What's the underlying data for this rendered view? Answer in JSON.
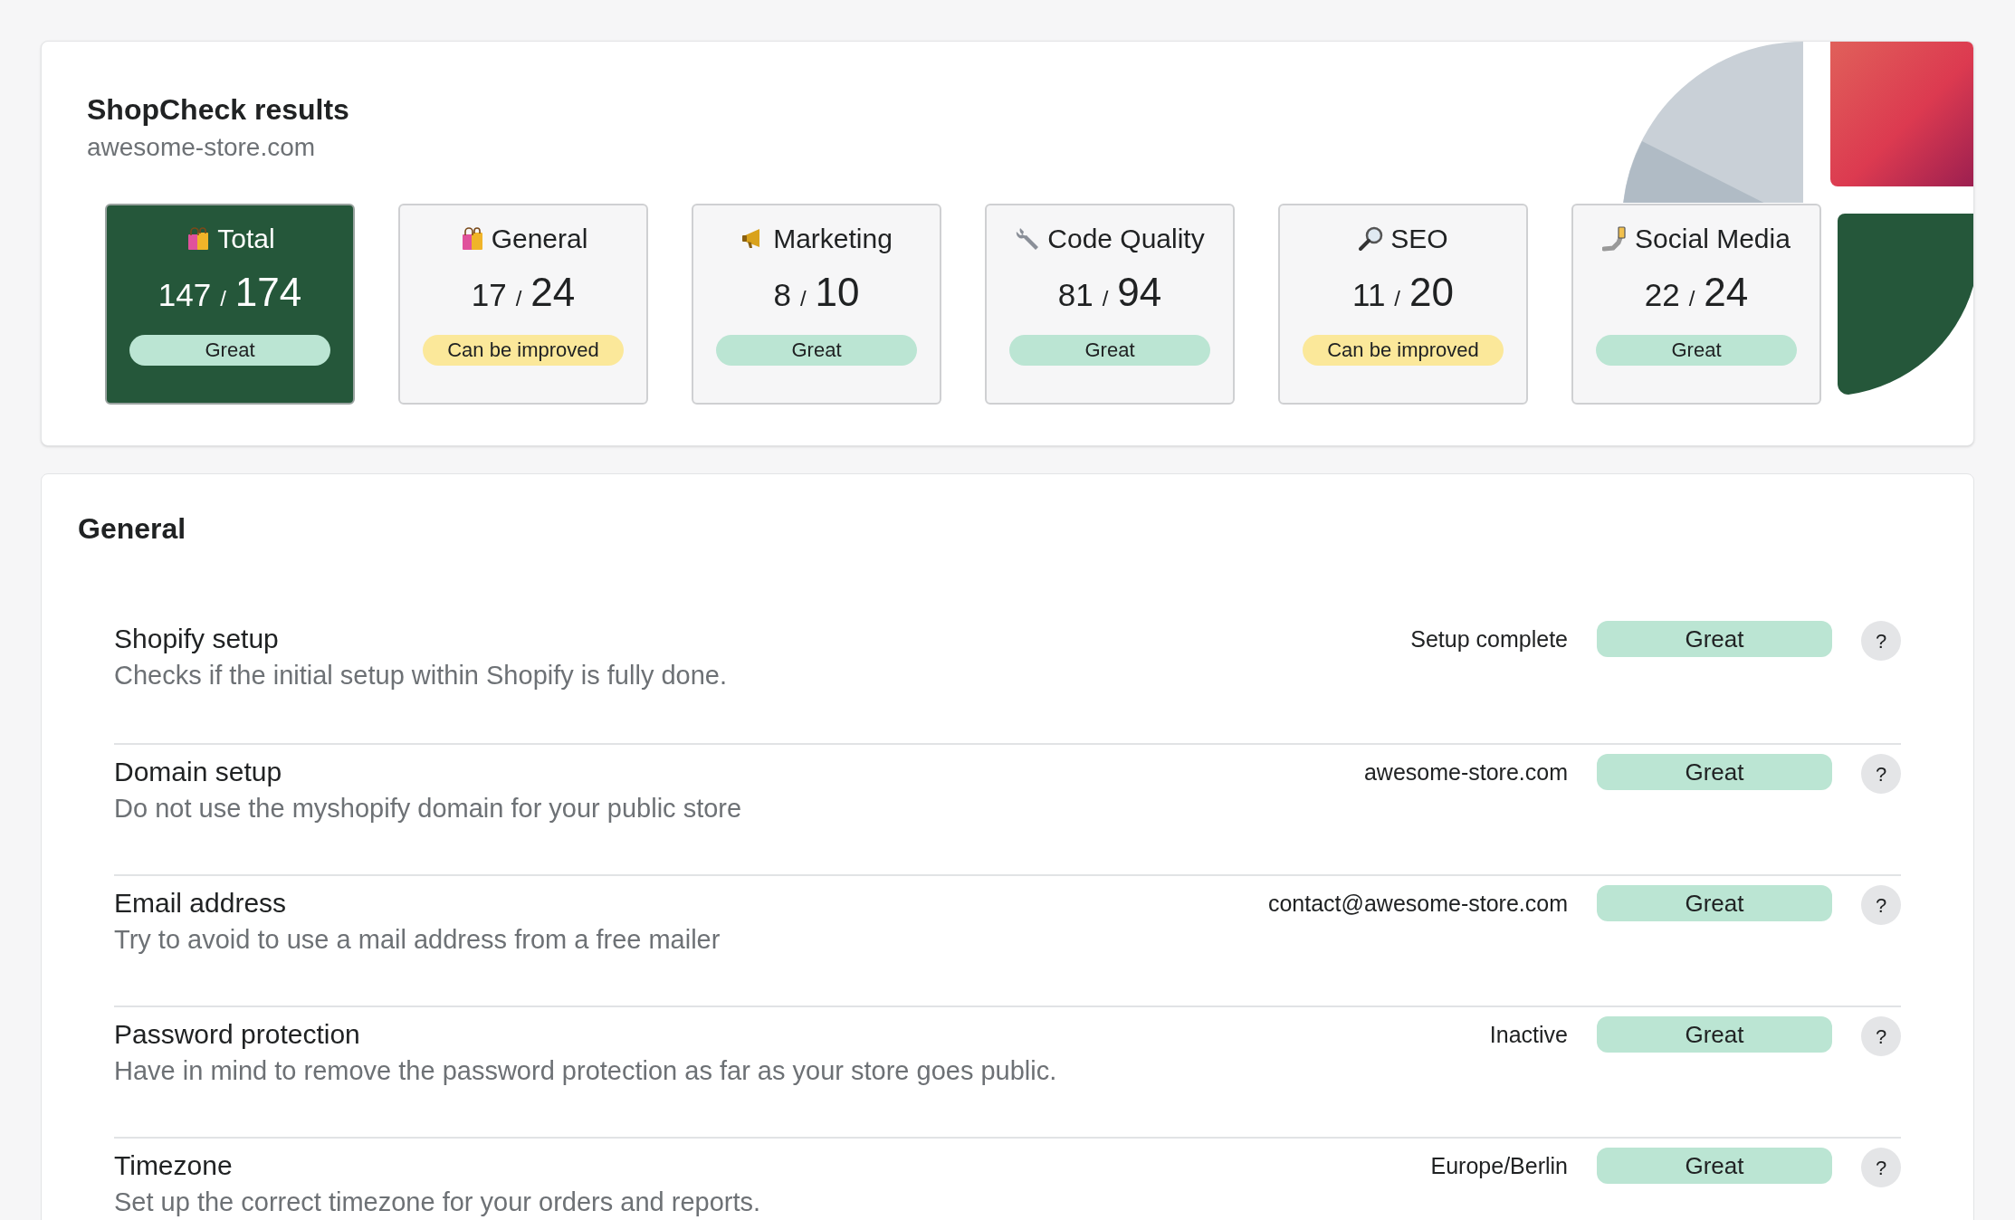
{
  "header": {
    "title": "ShopCheck results",
    "domain": "awesome-store.com"
  },
  "scores": [
    {
      "kind": "bags",
      "label": "Total",
      "score": "147",
      "separator": "/",
      "max": "174",
      "status": "Great",
      "color": "#bbe5d3",
      "selected": true
    },
    {
      "kind": "bags",
      "label": "General",
      "score": "17",
      "separator": "/",
      "max": "24",
      "status": "Can be improved",
      "color": "#fbe89a",
      "selected": false
    },
    {
      "kind": "megaphone",
      "label": "Marketing",
      "score": "8",
      "separator": "/",
      "max": "10",
      "status": "Great",
      "color": "#bbe5d3",
      "selected": false
    },
    {
      "kind": "wrench",
      "label": "Code Quality",
      "score": "81",
      "separator": "/",
      "max": "94",
      "status": "Great",
      "color": "#bbe5d3",
      "selected": false
    },
    {
      "kind": "magnifier",
      "label": "SEO",
      "score": "11",
      "separator": "/",
      "max": "20",
      "status": "Can be improved",
      "color": "#fbe89a",
      "selected": false
    },
    {
      "kind": "selfie",
      "label": "Social Media",
      "score": "22",
      "separator": "/",
      "max": "24",
      "status": "Great",
      "color": "#bbe5d3",
      "selected": false
    }
  ],
  "section": {
    "title": "General",
    "help_label": "?",
    "checks": [
      {
        "title": "Shopify setup",
        "description": "Checks if the initial setup within Shopify is fully done.",
        "value": "Setup complete",
        "status": "Great",
        "color": "#bbe5d3"
      },
      {
        "title": "Domain setup",
        "description": "Do not use the myshopify domain for your public store",
        "value": "awesome-store.com",
        "status": "Great",
        "color": "#bbe5d3"
      },
      {
        "title": "Email address",
        "description": "Try to avoid to use a mail address from a free mailer",
        "value": "contact@awesome-store.com",
        "status": "Great",
        "color": "#bbe5d3"
      },
      {
        "title": "Password protection",
        "description": "Have in mind to remove the password protection as far as your store goes public.",
        "value": "Inactive",
        "status": "Great",
        "color": "#bbe5d3"
      },
      {
        "title": "Timezone",
        "description": "Set up the correct timezone for your orders and reports.",
        "value": "Europe/Berlin",
        "status": "Great",
        "color": "#bbe5d3"
      }
    ]
  }
}
